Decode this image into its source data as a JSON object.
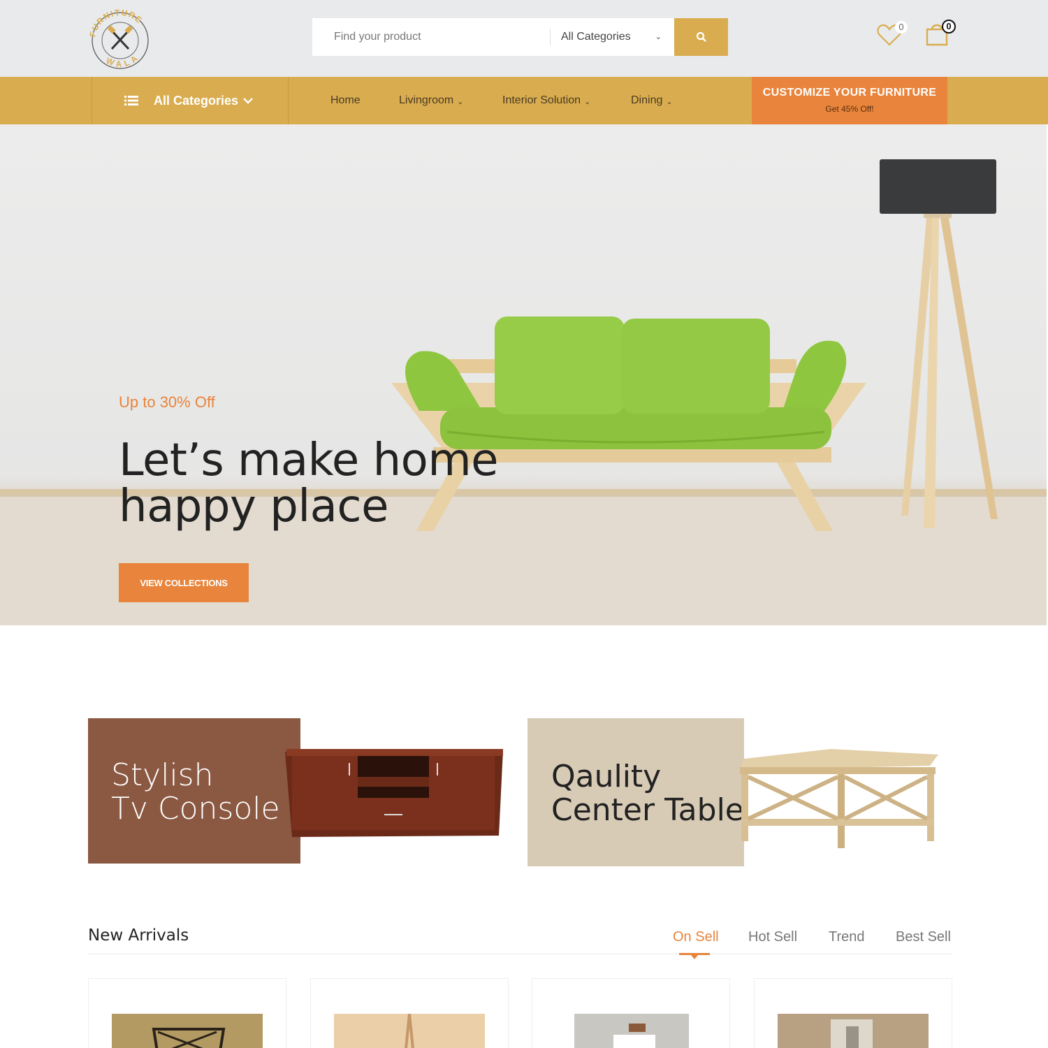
{
  "header": {
    "logo": {
      "ring_text_top": "FURNITURE",
      "ring_text_bottom": "WALA",
      "ring_url": "www.furniturewala.pk"
    },
    "search": {
      "placeholder": "Find your product",
      "category_selected": "All Categories"
    },
    "wishlist_count": "0",
    "cart_count": "0"
  },
  "nav": {
    "all_categories_label": "All Categories",
    "links": [
      {
        "label": "Home",
        "has_dropdown": false
      },
      {
        "label": "Livingroom",
        "has_dropdown": true
      },
      {
        "label": "Interior Solution",
        "has_dropdown": true
      },
      {
        "label": "Dining",
        "has_dropdown": true
      }
    ],
    "promo": {
      "title": "CUSTOMIZE YOUR FURNITURE",
      "subtitle": "Get 45% Off!"
    }
  },
  "hero": {
    "tagline": "Up to 30% Off",
    "title_line1": "Let’s make home",
    "title_line2": "happy place",
    "button_label": "VIEW COLLECTIONS"
  },
  "banners": [
    {
      "line1": "Stylish",
      "line2": "Tv Console"
    },
    {
      "line1": "Qaulity",
      "line2": "Center Table"
    }
  ],
  "arrivals": {
    "title": "New Arrivals",
    "tabs": [
      "On Sell",
      "Hot Sell",
      "Trend",
      "Best Sell"
    ],
    "active_tab": "On Sell"
  },
  "colors": {
    "brand_gold": "#d9ad4f",
    "accent_orange": "#e8843b",
    "header_bg": "#e9eaec",
    "tv_banner_bg": "#8b5842",
    "table_banner_bg": "#d8cbb6",
    "sofa_green": "#8fc640"
  }
}
